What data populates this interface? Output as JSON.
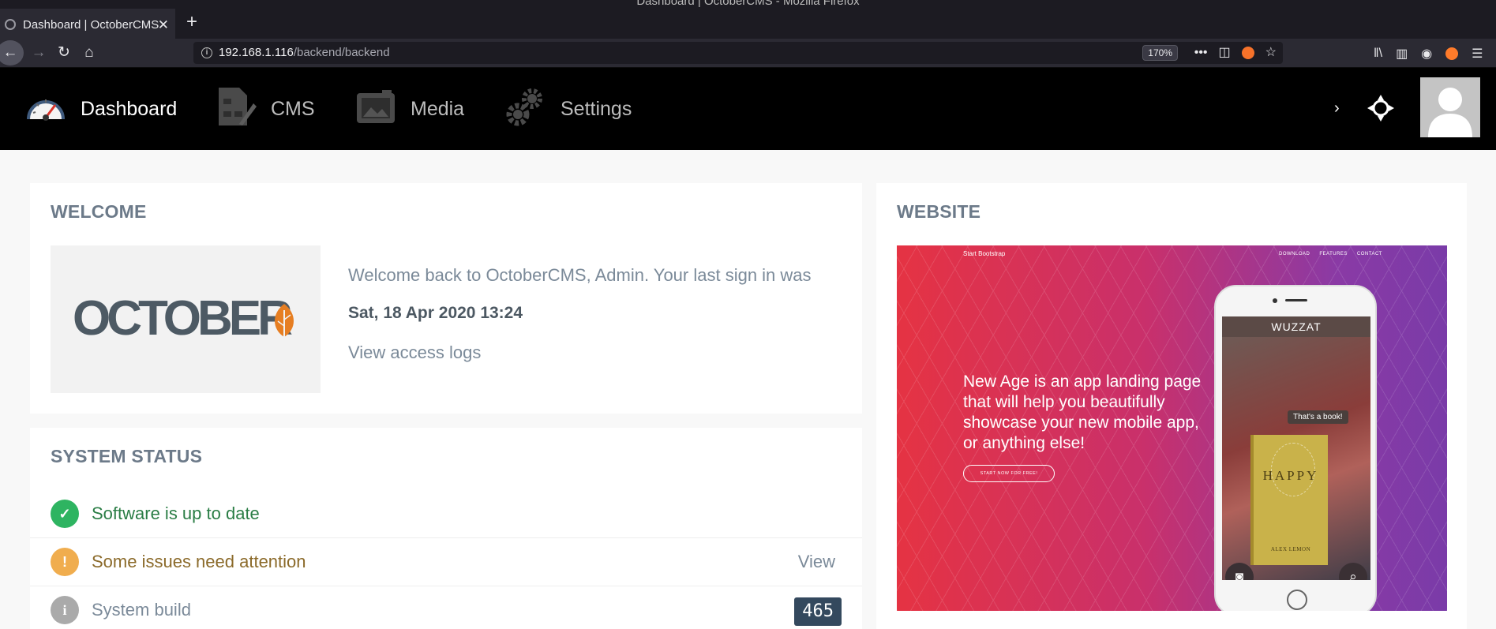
{
  "browser": {
    "window_title": "Dashboard | OctoberCMS - Mozilla Firefox",
    "tab_title": "Dashboard | OctoberCMS",
    "url_host": "192.168.1.116",
    "url_path": "/backend/backend",
    "zoom": "170%"
  },
  "header": {
    "menu": [
      {
        "label": "Dashboard",
        "icon": "dashboard-speedometer-icon"
      },
      {
        "label": "CMS",
        "icon": "cms-document-icon"
      },
      {
        "label": "Media",
        "icon": "media-camera-icon"
      },
      {
        "label": "Settings",
        "icon": "settings-gears-icon"
      }
    ],
    "chevron": "›"
  },
  "welcome": {
    "title": "WELCOME",
    "logo_text": "OCTOBER",
    "message": "Welcome back to OctoberCMS, Admin. Your last sign in was",
    "last_sign_in": "Sat, 18 Apr 2020 13:24",
    "access_logs_link": "View access logs"
  },
  "website": {
    "title": "WEBSITE",
    "preview": {
      "brand": "Start Bootstrap",
      "nav": [
        "DOWNLOAD",
        "FEATURES",
        "CONTACT"
      ],
      "headline": "New Age is an app landing page that will help you beautifully showcase your new mobile app, or anything else!",
      "cta": "START NOW FOR FREE!",
      "app_name": "WUZZAT",
      "bubble": "That's a book!",
      "book_title": "HAPPY",
      "book_author": "ALEX LEMON"
    }
  },
  "system_status": {
    "title": "SYSTEM STATUS",
    "rows": [
      {
        "label": "Software is up to date",
        "status": "ok"
      },
      {
        "label": "Some issues need attention",
        "status": "warning",
        "action": "View"
      },
      {
        "label": "System build",
        "status": "info",
        "value": "465"
      }
    ]
  },
  "colors": {
    "accent_ok": "#2eb461",
    "accent_warning": "#f0ad4e",
    "badge_bg": "#34495e",
    "header_bg": "#000000"
  }
}
